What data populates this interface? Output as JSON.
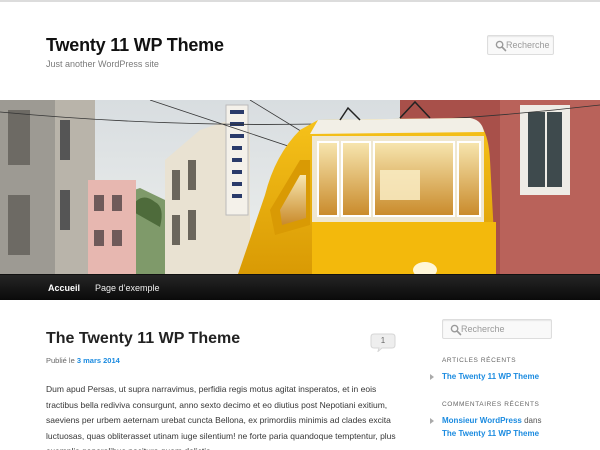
{
  "site": {
    "title": "Twenty 11 WP Theme",
    "description": "Just another WordPress site"
  },
  "header_search": {
    "placeholder": "Recherche"
  },
  "nav": {
    "items": [
      {
        "label": "Accueil",
        "current": true
      },
      {
        "label": "Page d’exemple",
        "current": false
      }
    ]
  },
  "post": {
    "title": "The Twenty 11 WP Theme",
    "comment_count": "1",
    "meta_prefix": "Publié le ",
    "date": "3 mars 2014",
    "content": "Dum apud Persas, ut supra narravimus, perfidia regis motus agitat insperatos, et in eois tractibus bella rediviva consurgunt, anno sexto decimo et eo diutius post Nepotiani exitium, saeviens per urbem aeternam urebat cuncta Bellona, ex primordiis minimis ad clades excita luctuosas, quas obliterasset utinam iuge silentium! ne forte paria quandoque temptentur, plus exemplis generalibus nocitura quam delictis."
  },
  "sidebar": {
    "search_placeholder": "Recherche",
    "recent_posts": {
      "title": "ARTICLES RÉCENTS",
      "items": [
        "The Twenty 11 WP Theme"
      ]
    },
    "recent_comments": {
      "title": "COMMENTAIRES RÉCENTS",
      "author": "Monsieur WordPress",
      "connector": " dans ",
      "post": "The Twenty 11 WP Theme"
    }
  },
  "colors": {
    "link": "#1b8be0",
    "nav_bg": "#111111",
    "tram_yellow": "#f2b705"
  },
  "icons": [
    "search-icon",
    "comment-bubble-icon"
  ]
}
